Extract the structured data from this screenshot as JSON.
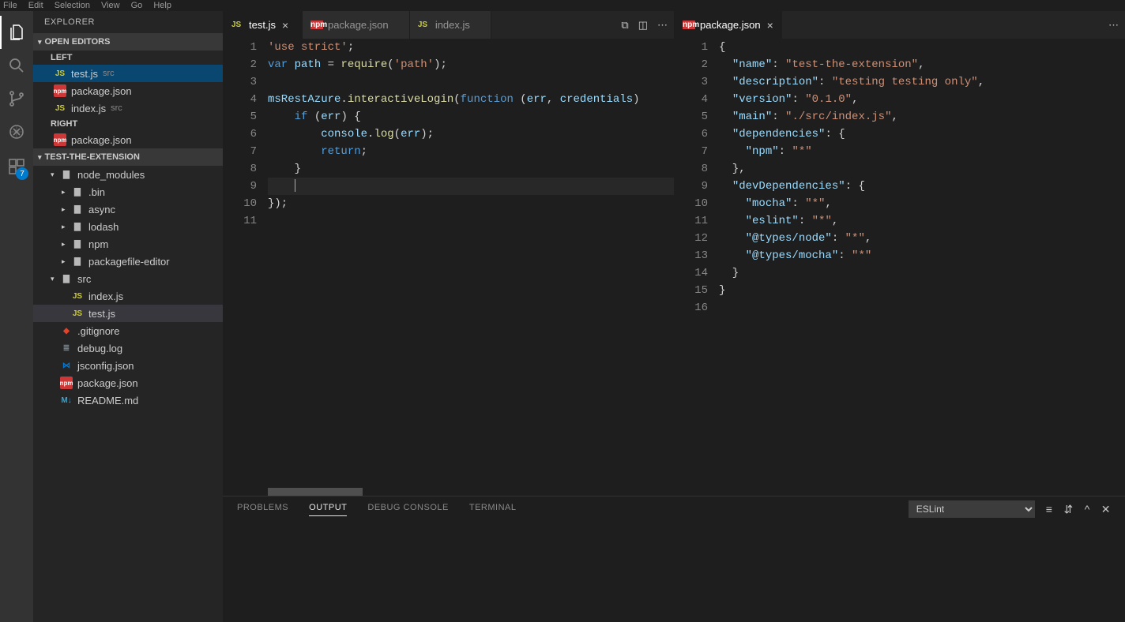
{
  "menubar": [
    "File",
    "Edit",
    "Selection",
    "View",
    "Go",
    "Help"
  ],
  "activity": {
    "badge": "7"
  },
  "sidebar": {
    "title": "EXPLORER",
    "openEditors": {
      "header": "OPEN EDITORS",
      "leftLabel": "LEFT",
      "rightLabel": "RIGHT",
      "left": [
        {
          "name": "test.js",
          "hint": "src",
          "icon": "js"
        },
        {
          "name": "package.json",
          "hint": "",
          "icon": "npm"
        },
        {
          "name": "index.js",
          "hint": "src",
          "icon": "js"
        }
      ],
      "right": [
        {
          "name": "package.json",
          "hint": "",
          "icon": "npm"
        }
      ]
    },
    "project": {
      "header": "TEST-THE-EXTENSION",
      "tree": [
        {
          "name": "node_modules",
          "icon": "folder",
          "expandable": true,
          "open": true,
          "depth": 1
        },
        {
          "name": ".bin",
          "icon": "folder",
          "expandable": true,
          "open": false,
          "depth": 2
        },
        {
          "name": "async",
          "icon": "folder",
          "expandable": true,
          "open": false,
          "depth": 2
        },
        {
          "name": "lodash",
          "icon": "folder",
          "expandable": true,
          "open": false,
          "depth": 2
        },
        {
          "name": "npm",
          "icon": "folder",
          "expandable": true,
          "open": false,
          "depth": 2
        },
        {
          "name": "packagefile-editor",
          "icon": "folder",
          "expandable": true,
          "open": false,
          "depth": 2
        },
        {
          "name": "src",
          "icon": "folder",
          "expandable": true,
          "open": true,
          "depth": 1
        },
        {
          "name": "index.js",
          "icon": "js",
          "expandable": false,
          "depth": 2
        },
        {
          "name": "test.js",
          "icon": "js",
          "expandable": false,
          "depth": 2,
          "selected": true
        },
        {
          "name": ".gitignore",
          "icon": "git",
          "expandable": false,
          "depth": 1
        },
        {
          "name": "debug.log",
          "icon": "log",
          "expandable": false,
          "depth": 1
        },
        {
          "name": "jsconfig.json",
          "icon": "vs",
          "expandable": false,
          "depth": 1
        },
        {
          "name": "package.json",
          "icon": "npm",
          "expandable": false,
          "depth": 1
        },
        {
          "name": "README.md",
          "icon": "md",
          "expandable": false,
          "depth": 1
        }
      ]
    }
  },
  "editorLeft": {
    "tabs": [
      {
        "label": "test.js",
        "icon": "js",
        "active": true
      },
      {
        "label": "package.json",
        "icon": "npm",
        "active": false
      },
      {
        "label": "index.js",
        "icon": "js",
        "active": false
      }
    ],
    "code": [
      [
        {
          "t": "str",
          "v": "'use strict'"
        },
        {
          "t": "punc",
          "v": ";"
        }
      ],
      [
        {
          "t": "kw",
          "v": "var"
        },
        {
          "t": "punc",
          "v": " "
        },
        {
          "t": "var",
          "v": "path"
        },
        {
          "t": "punc",
          "v": " = "
        },
        {
          "t": "fn",
          "v": "require"
        },
        {
          "t": "punc",
          "v": "("
        },
        {
          "t": "str",
          "v": "'path'"
        },
        {
          "t": "punc",
          "v": ");"
        }
      ],
      [],
      [
        {
          "t": "var",
          "v": "msRestAzure"
        },
        {
          "t": "punc",
          "v": "."
        },
        {
          "t": "fn",
          "v": "interactiveLogin"
        },
        {
          "t": "punc",
          "v": "("
        },
        {
          "t": "kw",
          "v": "function"
        },
        {
          "t": "punc",
          "v": " ("
        },
        {
          "t": "var",
          "v": "err"
        },
        {
          "t": "punc",
          "v": ", "
        },
        {
          "t": "var",
          "v": "credentials"
        },
        {
          "t": "punc",
          "v": ")"
        }
      ],
      [
        {
          "t": "punc",
          "v": "    "
        },
        {
          "t": "kw",
          "v": "if"
        },
        {
          "t": "punc",
          "v": " ("
        },
        {
          "t": "var",
          "v": "err"
        },
        {
          "t": "punc",
          "v": ") {"
        }
      ],
      [
        {
          "t": "punc",
          "v": "        "
        },
        {
          "t": "var",
          "v": "console"
        },
        {
          "t": "punc",
          "v": "."
        },
        {
          "t": "fn",
          "v": "log"
        },
        {
          "t": "punc",
          "v": "("
        },
        {
          "t": "var",
          "v": "err"
        },
        {
          "t": "punc",
          "v": ");"
        }
      ],
      [
        {
          "t": "punc",
          "v": "        "
        },
        {
          "t": "kw",
          "v": "return"
        },
        {
          "t": "punc",
          "v": ";"
        }
      ],
      [
        {
          "t": "punc",
          "v": "    }"
        }
      ],
      [
        {
          "t": "punc",
          "v": "    "
        }
      ],
      [
        {
          "t": "punc",
          "v": "});"
        }
      ],
      []
    ],
    "cursorLine": 9
  },
  "editorRight": {
    "tabs": [
      {
        "label": "package.json",
        "icon": "npm",
        "active": true
      }
    ],
    "code": [
      [
        {
          "t": "punc",
          "v": "{"
        }
      ],
      [
        {
          "t": "punc",
          "v": "  "
        },
        {
          "t": "prop",
          "v": "\"name\""
        },
        {
          "t": "punc",
          "v": ": "
        },
        {
          "t": "str",
          "v": "\"test-the-extension\""
        },
        {
          "t": "punc",
          "v": ","
        }
      ],
      [
        {
          "t": "punc",
          "v": "  "
        },
        {
          "t": "prop",
          "v": "\"description\""
        },
        {
          "t": "punc",
          "v": ": "
        },
        {
          "t": "str",
          "v": "\"testing testing only\""
        },
        {
          "t": "punc",
          "v": ","
        }
      ],
      [
        {
          "t": "punc",
          "v": "  "
        },
        {
          "t": "prop",
          "v": "\"version\""
        },
        {
          "t": "punc",
          "v": ": "
        },
        {
          "t": "str",
          "v": "\"0.1.0\""
        },
        {
          "t": "punc",
          "v": ","
        }
      ],
      [
        {
          "t": "punc",
          "v": "  "
        },
        {
          "t": "prop",
          "v": "\"main\""
        },
        {
          "t": "punc",
          "v": ": "
        },
        {
          "t": "str",
          "v": "\"./src/index.js\""
        },
        {
          "t": "punc",
          "v": ","
        }
      ],
      [
        {
          "t": "punc",
          "v": "  "
        },
        {
          "t": "prop",
          "v": "\"dependencies\""
        },
        {
          "t": "punc",
          "v": ": {"
        }
      ],
      [
        {
          "t": "punc",
          "v": "    "
        },
        {
          "t": "prop",
          "v": "\"npm\""
        },
        {
          "t": "punc",
          "v": ": "
        },
        {
          "t": "str",
          "v": "\"*\""
        }
      ],
      [
        {
          "t": "punc",
          "v": "  },"
        }
      ],
      [
        {
          "t": "punc",
          "v": "  "
        },
        {
          "t": "prop",
          "v": "\"devDependencies\""
        },
        {
          "t": "punc",
          "v": ": {"
        }
      ],
      [
        {
          "t": "punc",
          "v": "    "
        },
        {
          "t": "prop",
          "v": "\"mocha\""
        },
        {
          "t": "punc",
          "v": ": "
        },
        {
          "t": "str",
          "v": "\"*\""
        },
        {
          "t": "punc",
          "v": ","
        }
      ],
      [
        {
          "t": "punc",
          "v": "    "
        },
        {
          "t": "prop",
          "v": "\"eslint\""
        },
        {
          "t": "punc",
          "v": ": "
        },
        {
          "t": "str",
          "v": "\"*\""
        },
        {
          "t": "punc",
          "v": ","
        }
      ],
      [
        {
          "t": "punc",
          "v": "    "
        },
        {
          "t": "prop",
          "v": "\"@types/node\""
        },
        {
          "t": "punc",
          "v": ": "
        },
        {
          "t": "str",
          "v": "\"*\""
        },
        {
          "t": "punc",
          "v": ","
        }
      ],
      [
        {
          "t": "punc",
          "v": "    "
        },
        {
          "t": "prop",
          "v": "\"@types/mocha\""
        },
        {
          "t": "punc",
          "v": ": "
        },
        {
          "t": "str",
          "v": "\"*\""
        }
      ],
      [
        {
          "t": "punc",
          "v": "  }"
        }
      ],
      [
        {
          "t": "punc",
          "v": "}"
        }
      ],
      []
    ]
  },
  "panel": {
    "tabs": [
      "PROBLEMS",
      "OUTPUT",
      "DEBUG CONSOLE",
      "TERMINAL"
    ],
    "active": 1,
    "dropdown": "ESLint"
  }
}
